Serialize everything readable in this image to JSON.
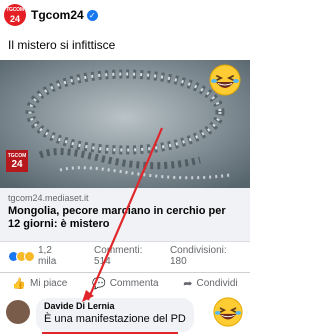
{
  "header": {
    "page_name": "Tgcom24",
    "avatar_line1": "TGCOM",
    "avatar_line2": "24"
  },
  "post": {
    "text": "Il mistero si infittisce",
    "media_logo_line1": "TGCOM",
    "media_logo_line2": "24"
  },
  "link_preview": {
    "domain": "tgcom24.mediaset.it",
    "title": "Mongolia, pecore marciano in cerchio per 12 giorni: è mistero"
  },
  "stats": {
    "reactions": "1,2 mila",
    "comments": "Commenti: 514",
    "shares": "Condivisioni: 180"
  },
  "actions": {
    "like": "Mi piace",
    "comment": "Commenta",
    "share": "Condividi"
  },
  "comment": {
    "author": "Davide Di Lernia",
    "text": "È una manifestazione del PD"
  },
  "colors": {
    "brand_red": "#e31e24",
    "annotation_red": "#e0262a",
    "facebook_blue": "#1877f2"
  }
}
